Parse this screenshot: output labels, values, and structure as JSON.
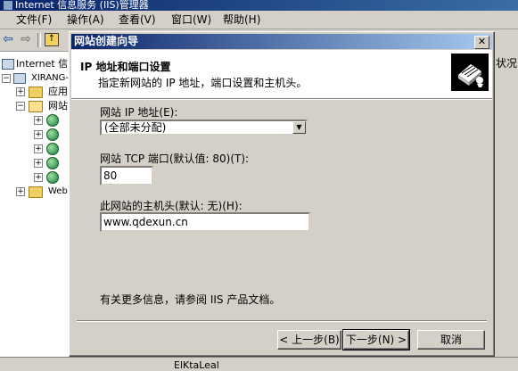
{
  "main_window": {
    "title": "Internet 信息服务 (IIS)管理器",
    "menu": [
      "文件(F)",
      "操作(A)",
      "查看(V)",
      "窗口(W)",
      "帮助(H)"
    ],
    "tree": {
      "root": "Internet 信",
      "server": "XIRANG-",
      "apps": "应用",
      "websites": "网站",
      "web_ext": "Web"
    },
    "status_header": "状况",
    "bottom_fragment": "ElKtaLeal"
  },
  "wizard": {
    "title": "网站创建向导",
    "close_label": "✕",
    "header": {
      "title": "IP 地址和端口设置",
      "subtitle": "指定新网站的 IP 地址，端口设置和主机头。"
    },
    "ip_label": "网站 IP 地址(E):",
    "ip_value": "(全部未分配)",
    "port_label": "网站 TCP 端口(默认值: 80)(T):",
    "port_value": "80",
    "host_label": "此网站的主机头(默认: 无)(H):",
    "host_value": "www.qdexun.cn",
    "info_text": "有关更多信息，请参阅 IIS 产品文档。",
    "buttons": {
      "back": "< 上一步(B)",
      "next": "下一步(N) >",
      "cancel": "取消"
    }
  }
}
